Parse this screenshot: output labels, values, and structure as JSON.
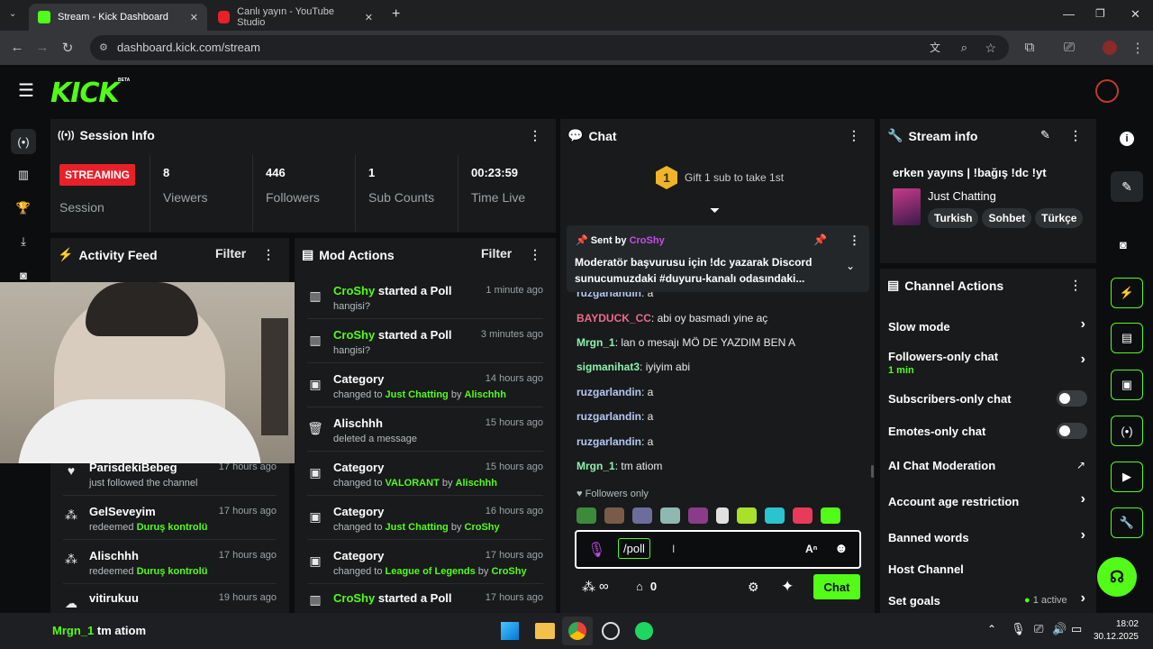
{
  "browser": {
    "tabs": [
      {
        "title": "Stream - Kick Dashboard",
        "active": true
      },
      {
        "title": "Canlı yayın - YouTube Studio",
        "active": false
      }
    ],
    "url": "dashboard.kick.com/stream"
  },
  "kick": {
    "logo": "KICK",
    "beta": "BETA"
  },
  "session": {
    "title": "Session Info",
    "status": "STREAMING",
    "status_label": "Session",
    "stats": [
      {
        "value": "8",
        "label": "Viewers"
      },
      {
        "value": "446",
        "label": "Followers"
      },
      {
        "value": "1",
        "label": "Sub Counts"
      },
      {
        "value": "00:23:59",
        "label": "Time Live"
      }
    ]
  },
  "activity": {
    "title": "Activity Feed",
    "filter": "Filter",
    "items": [
      {
        "name": "ParisdekiBebeg",
        "sub_prefix": "just followed the channel",
        "highlight": "",
        "time": "17 hours ago"
      },
      {
        "name": "GelSeveyim",
        "sub_prefix": "redeemed ",
        "highlight": "Duruş kontrolü",
        "time": "17 hours ago"
      },
      {
        "name": "Alischhh",
        "sub_prefix": "redeemed ",
        "highlight": "Duruş kontrolü",
        "time": "17 hours ago"
      },
      {
        "name": "vitirukuu",
        "sub_prefix": "",
        "highlight": "",
        "time": "19 hours ago"
      }
    ]
  },
  "mod": {
    "title": "Mod Actions",
    "filter": "Filter",
    "items": [
      {
        "actor": "CroShy",
        "action": "started a Poll",
        "sub": "hangisi?",
        "time": "1 minute ago"
      },
      {
        "actor": "CroShy",
        "action": "started a Poll",
        "sub": "hangisi?",
        "time": "3 minutes ago"
      },
      {
        "actor": "",
        "action": "Category",
        "sub": "changed to ",
        "cat": "Just Chatting",
        "by": "Alischhh",
        "time": "14 hours ago"
      },
      {
        "actor": "",
        "action": "Alischhh",
        "sub": "deleted a message",
        "time": "15 hours ago"
      },
      {
        "actor": "",
        "action": "Category",
        "sub": "changed to ",
        "cat": "VALORANT",
        "by": "Alischhh",
        "time": "15 hours ago"
      },
      {
        "actor": "",
        "action": "Category",
        "sub": "changed to ",
        "cat": "Just Chatting",
        "by": "CroShy",
        "time": "16 hours ago"
      },
      {
        "actor": "",
        "action": "Category",
        "sub": "changed to ",
        "cat": "League of Legends",
        "by": "CroShy",
        "time": "17 hours ago"
      },
      {
        "actor": "CroShy",
        "action": "started a Poll",
        "sub": "",
        "time": "17 hours ago"
      }
    ],
    "by_word": " by "
  },
  "chat": {
    "title": "Chat",
    "gift_count": "1",
    "gift_text": "Gift 1 sub to take 1st",
    "pinned_label": "Sent by",
    "pinned_user": "CroShy",
    "pinned_text": "Moderatör başvurusu için !dc yazarak Discord sunucumuzdaki #duyuru-kanalı odasındaki...",
    "messages": [
      {
        "user": "ruzgarlandin",
        "text": ": a",
        "color": "#b6c8f5"
      },
      {
        "user": "BAYDUCK_CC",
        "text": ": abi oy basmadı yine aç",
        "color": "#f06a8b"
      },
      {
        "user": "Mrgn_1",
        "text": ": lan o mesajı MÖ DE YAZDIM BEN A",
        "color": "#8ff0b0"
      },
      {
        "user": "sigmanihat3",
        "text": ": iyiyim abi",
        "color": "#8ff0b0"
      },
      {
        "user": "ruzgarlandin",
        "text": ": a",
        "color": "#b6c8f5"
      },
      {
        "user": "ruzgarlandin",
        "text": ": a",
        "color": "#b6c8f5"
      },
      {
        "user": "ruzgarlandin",
        "text": ": a",
        "color": "#b6c8f5"
      },
      {
        "user": "Mrgn_1",
        "text": ": tm atiom",
        "color": "#8ff0b0"
      }
    ],
    "followers_only": "Followers only",
    "input_value": "/poll",
    "infinite": "∞",
    "points": "0",
    "send": "Chat"
  },
  "stream_info": {
    "title": "Stream info",
    "stream_title": "erken yayıns | !bağış !dc !yt",
    "category": "Just Chatting",
    "tags": [
      "Turkish",
      "Sohbet",
      "Türkçe"
    ]
  },
  "channel_actions": {
    "title": "Channel Actions",
    "items": [
      {
        "label": "Slow mode",
        "control": "chevron"
      },
      {
        "label": "Followers-only chat",
        "sub": "1 min",
        "control": "chevron"
      },
      {
        "label": "Subscribers-only chat",
        "control": "toggle"
      },
      {
        "label": "Emotes-only chat",
        "control": "toggle"
      },
      {
        "label": "AI Chat Moderation",
        "control": "external"
      },
      {
        "label": "Account age restriction",
        "control": "chevron"
      },
      {
        "label": "Banned words",
        "control": "chevron"
      },
      {
        "label": "Host Channel",
        "control": "none"
      },
      {
        "label": "Set goals",
        "sub": "1 active",
        "control": "chevron"
      }
    ]
  },
  "taskbar": {
    "overlay_user": "Mrgn_1",
    "overlay_text": "tm atiom",
    "time": "18:02",
    "date": "30.12.2025"
  },
  "colors": {
    "accent": "#53fc18",
    "live": "#e8202a",
    "panel": "#181a1b"
  }
}
